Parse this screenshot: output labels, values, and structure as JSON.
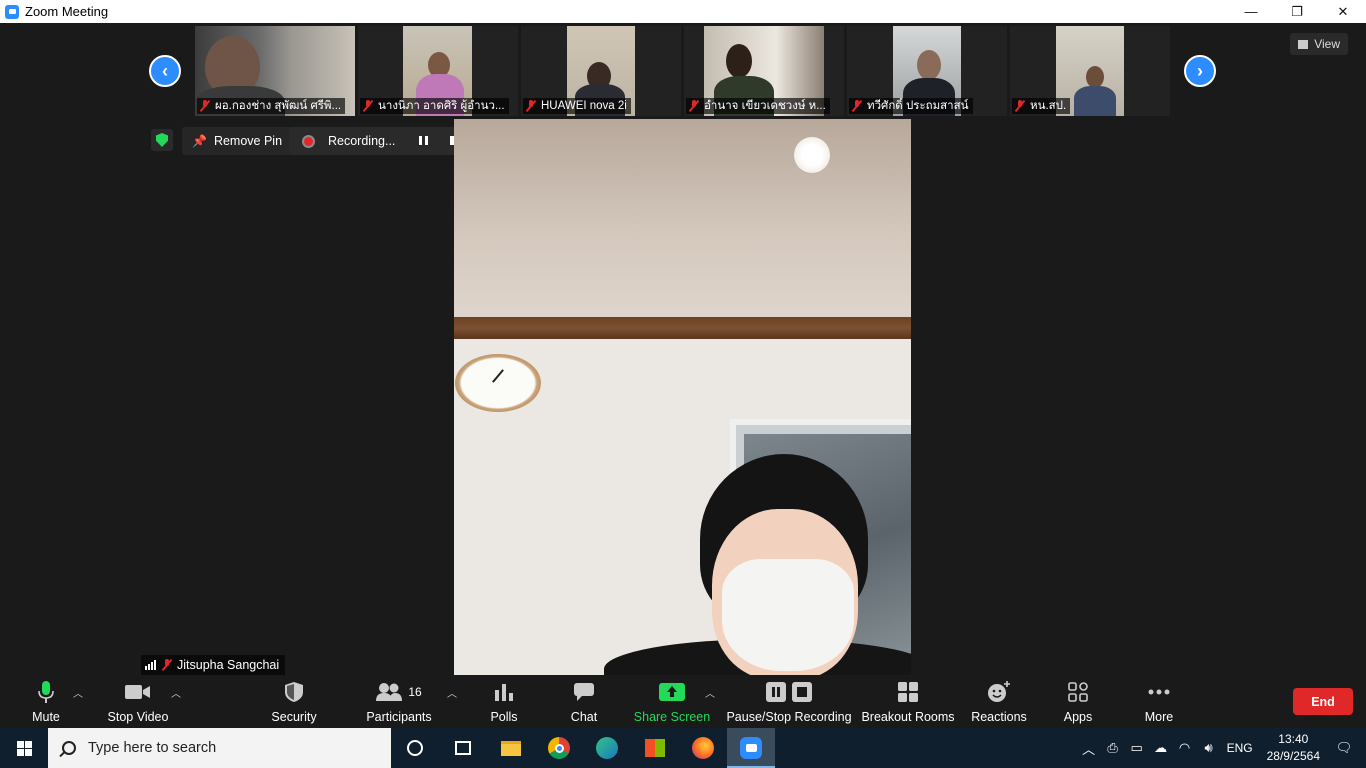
{
  "window": {
    "title": "Zoom Meeting",
    "minimize": "—",
    "maximize": "❐",
    "close": "✕"
  },
  "gallery": {
    "prev": "‹",
    "next": "›",
    "view_label": "View",
    "participants": [
      {
        "name": "ผอ.กองช่าง สุพัฒน์ ศรีพิ..."
      },
      {
        "name": "นางนิภา อาดศิริ ผู้อำนว..."
      },
      {
        "name": "HUAWEI nova 2i"
      },
      {
        "name": "อำนาจ เขียวเดชวงษ์ ห..."
      },
      {
        "name": "ทวีศักดิ์ ประถมสาสน์"
      },
      {
        "name": "หน.สป."
      }
    ]
  },
  "pinbar": {
    "remove_pin": "Remove Pin",
    "recording": "Recording..."
  },
  "active_speaker": {
    "name": "Jitsupha Sangchai"
  },
  "toolbar": {
    "mute": "Mute",
    "stop_video": "Stop Video",
    "security": "Security",
    "participants": "Participants",
    "participants_count": "16",
    "polls": "Polls",
    "chat": "Chat",
    "share_screen": "Share Screen",
    "pause_stop_recording": "Pause/Stop Recording",
    "breakout_rooms": "Breakout Rooms",
    "reactions": "Reactions",
    "apps": "Apps",
    "more": "More",
    "end": "End"
  },
  "taskbar": {
    "search_placeholder": "Type here to search",
    "language": "ENG",
    "time": "13:40",
    "date": "28/9/2564"
  },
  "colors": {
    "accent": "#2d8cff",
    "end": "#e02828",
    "share": "#23d959"
  }
}
